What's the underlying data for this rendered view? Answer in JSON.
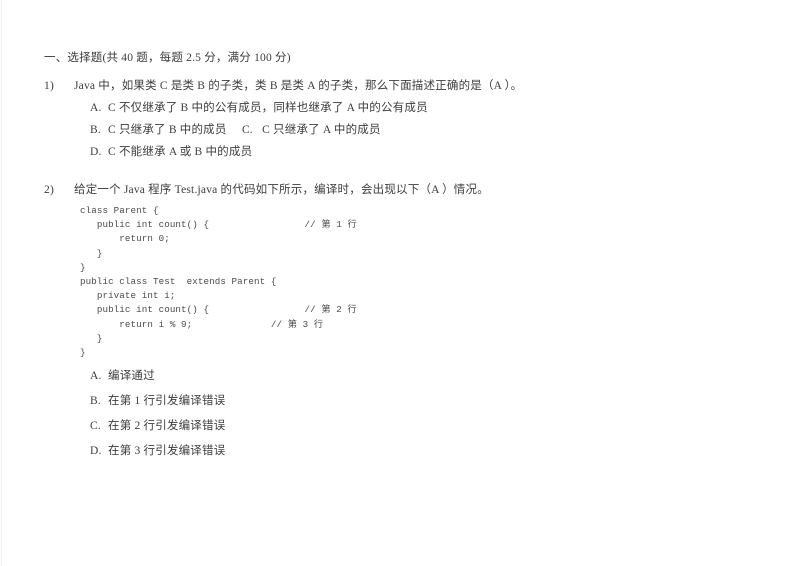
{
  "document": {
    "section_heading": "一、选择题(共 40 题，每题 2.5 分，满分 100 分)",
    "questions": [
      {
        "number": "1)",
        "stem": "Java 中，如果类 C 是类 B 的子类，类 B 是类 A 的子类，那么下面描述正确的是（A ）。",
        "options": [
          {
            "label": "A.",
            "text": "C 不仅继承了 B 中的公有成员，同样也继承了 A 中的公有成员"
          },
          {
            "label": "B.",
            "text": "C 只继承了 B 中的成员     C.   C 只继承了 A 中的成员"
          },
          {
            "label": "D.",
            "text": "C 不能继承 A 或 B 中的成员"
          }
        ]
      },
      {
        "number": "2)",
        "stem": "给定一个 Java 程序 Test.java 的代码如下所示，编译时，会出现以下（A ）情况。",
        "code": [
          "class Parent {",
          "   public int count() {                 // 第 1 行",
          "       return 0;",
          "   }",
          "}",
          "public class Test  extends Parent {",
          "   private int i;",
          "   public int count() {                 // 第 2 行",
          "       return i % 9;              // 第 3 行",
          "   }",
          "}"
        ],
        "options": [
          {
            "label": "A.",
            "text": "编译通过"
          },
          {
            "label": "B.",
            "text": "在第 1 行引发编译错误"
          },
          {
            "label": "C.",
            "text": "在第 2 行引发编译错误"
          },
          {
            "label": "D.",
            "text": "在第 3 行引发编译错误"
          }
        ]
      }
    ]
  }
}
